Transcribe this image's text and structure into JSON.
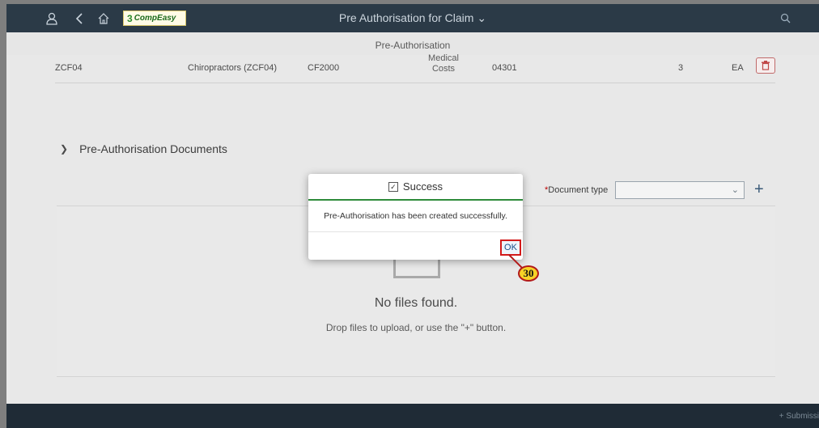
{
  "shell": {
    "title": "Pre Authorisation for Claim",
    "logo_text": "CompEasy",
    "icons": [
      "user-icon",
      "back-icon",
      "home-icon",
      "search-icon"
    ]
  },
  "subheader": "Pre-Authorisation",
  "item_row": {
    "code": "ZCF04",
    "description": "Chiropractors (ZCF04)",
    "reference": "CF2000",
    "category_line1": "Medical",
    "category_line2": "Costs",
    "tariff": "04301",
    "quantity": "3",
    "unit": "EA"
  },
  "documents": {
    "section_title": "Pre-Authorisation Documents",
    "required_mark": "*",
    "doctype_label": "Document type",
    "doctype_value": "",
    "empty_title": "No files found.",
    "empty_hint": "Drop files to upload, or use the \"+\" button."
  },
  "dialog": {
    "title": "Success",
    "message": "Pre-Authorisation has been created successfully.",
    "ok_label": "OK"
  },
  "annotation": {
    "step": "30"
  },
  "footer": {
    "action_label": "Submissi"
  },
  "colors": {
    "shell": "#2b3a47",
    "success": "#2e8b3a",
    "highlight": "#d31a1a",
    "badge": "#f7d227"
  }
}
